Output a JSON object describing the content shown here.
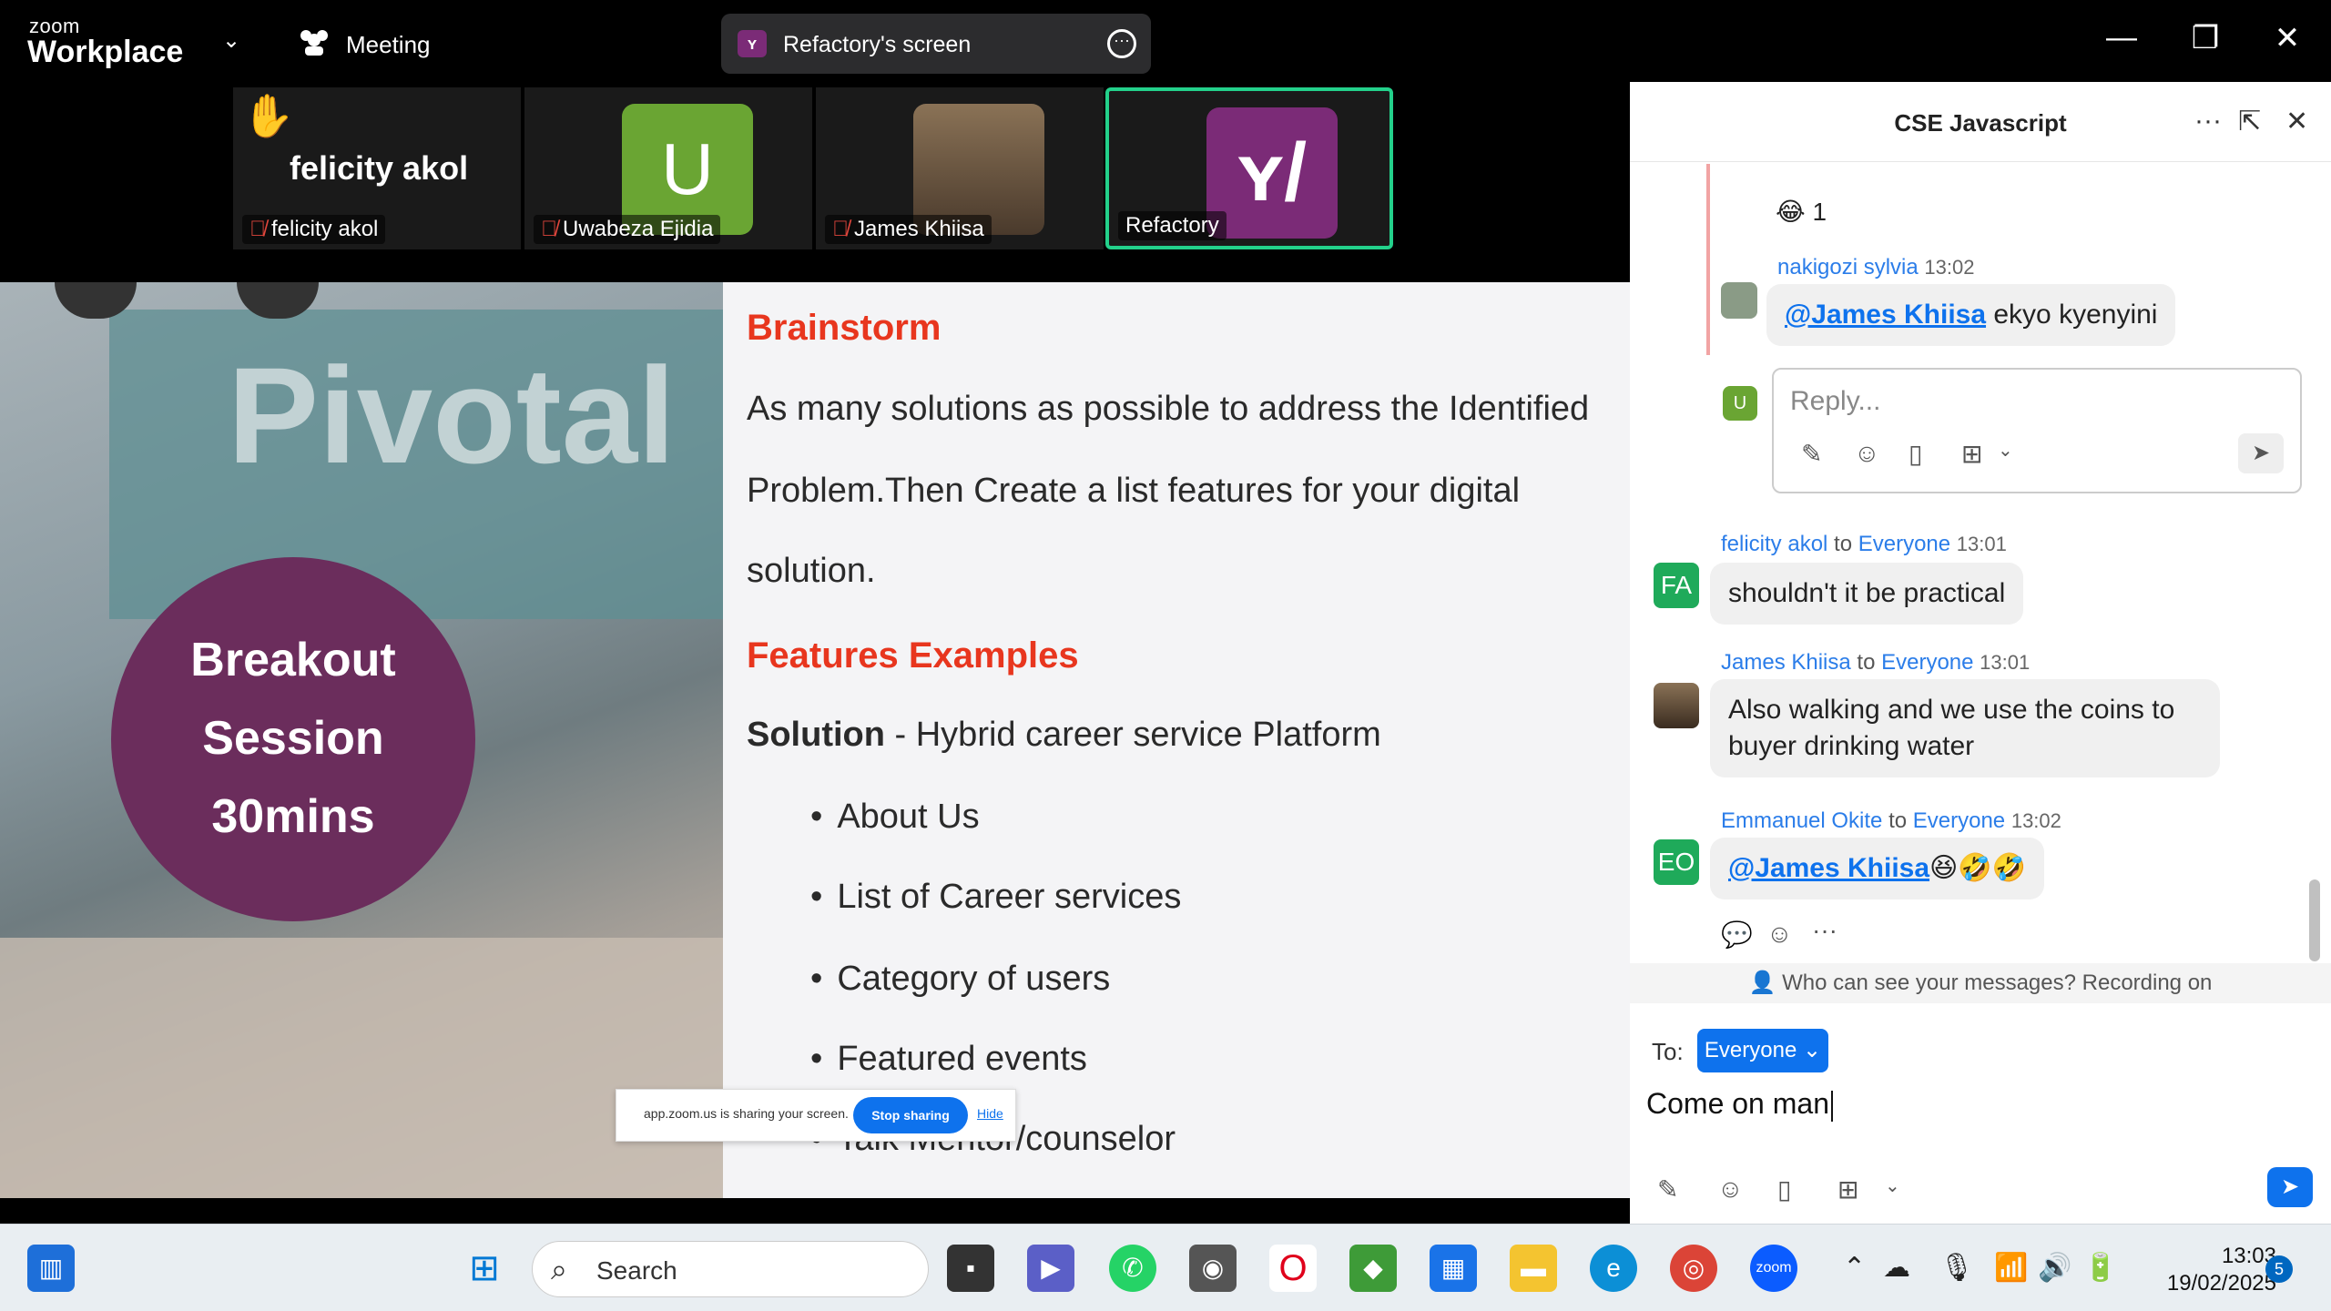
{
  "titlebar": {
    "brand_small": "zoom",
    "brand_big": "Workplace",
    "meeting_label": "Meeting",
    "screen_label": "Refactory's screen"
  },
  "participants": [
    {
      "name": "felicity akol",
      "big_name": "felicity akol",
      "raised_hand": true,
      "muted": true
    },
    {
      "name": "Uwabeza Ejidia",
      "initial": "U",
      "color": "#6aa533",
      "muted": true
    },
    {
      "name": "James Khiisa",
      "muted": true
    },
    {
      "name": "Refactory",
      "color": "#7b2b77",
      "active": true
    }
  ],
  "slide": {
    "badge": [
      "Breakout",
      "Session",
      "30mins"
    ],
    "photo_text": "Pivotal",
    "heading1": "Brainstorm",
    "para_lines": [
      "As many solutions as possible to address the Identified",
      "Problem.Then Create a list features for your digital",
      "solution."
    ],
    "heading2": "Features Examples",
    "solution_bold": "Solution",
    "solution_rest": " - Hybrid career service Platform",
    "bullets": [
      "About Us",
      "List of Career services",
      "Category of users",
      "Featured events",
      "Talk Mentor/counselor"
    ]
  },
  "sharebar": {
    "text": "app.zoom.us is sharing your screen.",
    "stop": "Stop sharing",
    "hide": "Hide"
  },
  "chat": {
    "title": "CSE Javascript",
    "reaction_count": "1",
    "reply_placeholder": "Reply...",
    "messages": [
      {
        "sender": "nakigozi sylvia",
        "time": "13:02",
        "mention": "@James Khiisa",
        "text": " ekyo kyenyini"
      },
      {
        "sender": "felicity akol",
        "to": "to",
        "recipient": "Everyone",
        "time": "13:01",
        "initials": "FA",
        "text": "shouldn't it be practical"
      },
      {
        "sender": "James Khiisa",
        "to": "to",
        "recipient": "Everyone",
        "time": "13:01",
        "text_lines": [
          "Also walking and we use the coins to",
          "buyer drinking water"
        ]
      },
      {
        "sender": "Emmanuel Okite",
        "to": "to",
        "recipient": "Everyone",
        "time": "13:02",
        "initials": "EO",
        "mention": "@James Khiisa",
        "emoji": "😆🤣🤣"
      }
    ],
    "notice": "Who can see your messages? Recording on",
    "to_label": "To:",
    "to_value": "Everyone",
    "composer_value": "Come on man"
  },
  "taskbar": {
    "search_label": "Search",
    "time": "13:03",
    "date": "19/02/2025",
    "notif_count": "5"
  }
}
